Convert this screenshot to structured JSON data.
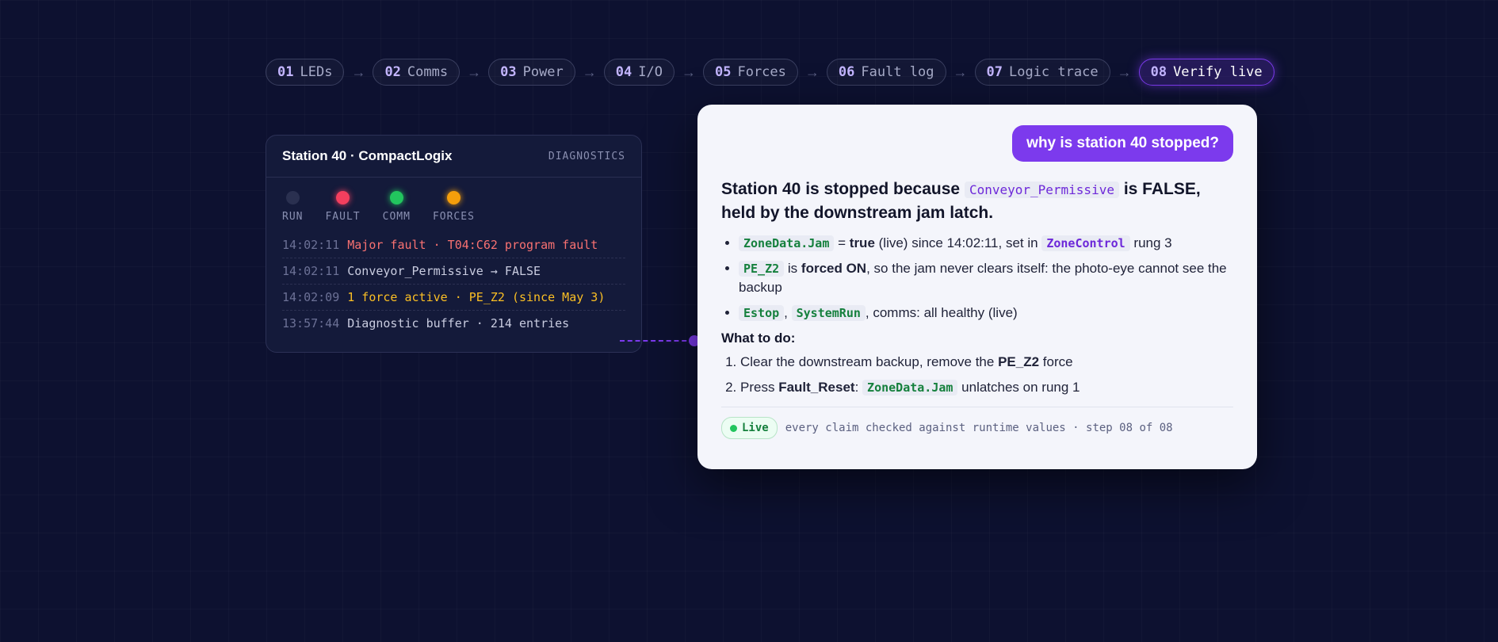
{
  "steps": [
    {
      "num": "01",
      "label": "LEDs"
    },
    {
      "num": "02",
      "label": "Comms"
    },
    {
      "num": "03",
      "label": "Power"
    },
    {
      "num": "04",
      "label": "I/O"
    },
    {
      "num": "05",
      "label": "Forces"
    },
    {
      "num": "06",
      "label": "Fault log"
    },
    {
      "num": "07",
      "label": "Logic trace"
    },
    {
      "num": "08",
      "label": "Verify live"
    }
  ],
  "arrow_glyph": "→",
  "diagnostics": {
    "title": "Station 40 · CompactLogix",
    "tag": "DIAGNOSTICS",
    "leds": [
      {
        "label": "RUN",
        "color": "#2a3050"
      },
      {
        "label": "FAULT",
        "color": "#f43f5e"
      },
      {
        "label": "COMM",
        "color": "#22c55e"
      },
      {
        "label": "FORCES",
        "color": "#f59e0b"
      }
    ],
    "log": [
      {
        "time": "14:02:11",
        "text": "Major fault · T04:C62 program fault",
        "color": "#f87171"
      },
      {
        "time": "14:02:11",
        "text": "Conveyor_Permissive → FALSE",
        "color": "#c9cce0"
      },
      {
        "time": "14:02:09",
        "text": "1 force active · PE_Z2 (since May 3)",
        "color": "#fbbf24"
      },
      {
        "time": "13:57:44",
        "text": "Diagnostic buffer · 214 entries",
        "color": "#c9cce0"
      }
    ]
  },
  "answer": {
    "question": "why is station 40 stopped?",
    "headline": {
      "pre": "Station 40 is stopped because",
      "code": "Conveyor_Permissive",
      "post": "is FALSE, held by the downstream jam latch."
    },
    "bullets": {
      "b1": {
        "code1": "ZoneData.Jam",
        "t1": "=",
        "strong": "true",
        "t2": "(live) since 14:02:11, set in",
        "code2": "ZoneControl",
        "t3": "rung 3"
      },
      "b2": {
        "code": "PE_Z2",
        "t1": "is",
        "strong": "forced ON",
        "t2": ", so the jam never clears itself: the photo-eye cannot see the backup"
      },
      "b3": {
        "code1": "Estop",
        "sep": ",",
        "code2": "SystemRun",
        "t1": ", comms: all healthy (live)"
      }
    },
    "todo_title": "What to do:",
    "todo": {
      "s1": {
        "t1": "Clear the downstream backup, remove the",
        "strong": "PE_Z2",
        "t2": "force"
      },
      "s2": {
        "t1": "Press",
        "strong": "Fault_Reset",
        "t2": ":",
        "code": "ZoneData.Jam",
        "t3": "unlatches on rung 1"
      }
    },
    "footer": {
      "badge": "Live",
      "text": "every claim checked against runtime values · step 08 of 08"
    }
  },
  "colors": {
    "accent": "#7c3aed",
    "live": "#22c55e"
  }
}
